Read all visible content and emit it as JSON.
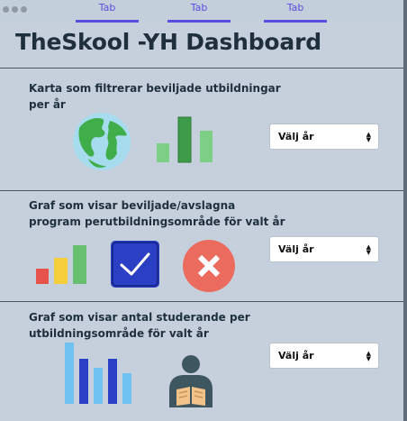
{
  "tabs": [
    {
      "label": "Tab"
    },
    {
      "label": "Tab"
    },
    {
      "label": "Tab"
    }
  ],
  "page_title": "TheSkool -YH Dashboard",
  "sections": [
    {
      "label": "Karta som filtrerar beviljade utbildningar per år",
      "select_value": "Välj år",
      "icons": [
        "globe-icon",
        "bar-chart-icon"
      ]
    },
    {
      "label": "Graf som visar beviljade/avslagna program perutbildningsområde för valt år",
      "select_value": "Välj år",
      "icons": [
        "bar-chart-icon",
        "checkmark-icon",
        "cross-icon"
      ]
    },
    {
      "label": "Graf som visar antal studerande per utbildningsområde för valt år",
      "select_value": "Välj år",
      "icons": [
        "bar-chart-icon",
        "reader-icon"
      ]
    }
  ],
  "colors": {
    "background": "#c5d0dc",
    "tab_accent": "#5b4de0",
    "title": "#1f2f3d"
  }
}
